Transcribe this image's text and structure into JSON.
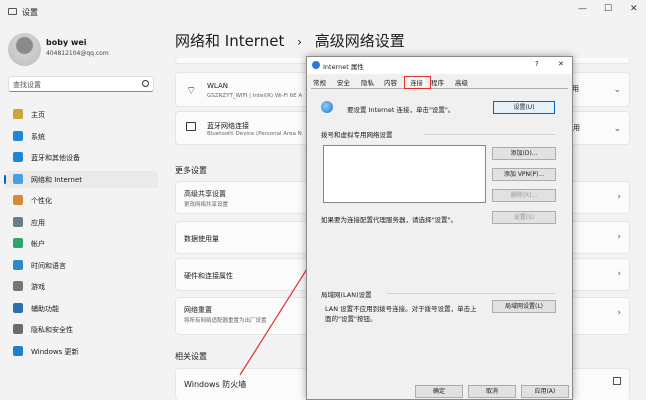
{
  "window": {
    "title": "设置",
    "controls": [
      "—",
      "☐",
      "✕"
    ]
  },
  "user": {
    "name": "boby wei",
    "email": "404812104@qq.com"
  },
  "search": {
    "placeholder": "查找设置"
  },
  "nav": [
    {
      "label": "主页",
      "icon": "home-icon",
      "color": "#c9a53b"
    },
    {
      "label": "系统",
      "icon": "system-icon",
      "color": "#1f86d6"
    },
    {
      "label": "蓝牙和其他设备",
      "icon": "bluetooth-icon",
      "color": "#1f86d6"
    },
    {
      "label": "网络和 Internet",
      "icon": "wifi-icon",
      "color": "#4a9fe0"
    },
    {
      "label": "个性化",
      "icon": "brush-icon",
      "color": "#d88a3a"
    },
    {
      "label": "应用",
      "icon": "apps-icon",
      "color": "#6e7b8b"
    },
    {
      "label": "帐户",
      "icon": "account-icon",
      "color": "#2ea36b"
    },
    {
      "label": "时间和语言",
      "icon": "globe-icon",
      "color": "#2e8bc9"
    },
    {
      "label": "游戏",
      "icon": "game-icon",
      "color": "#777"
    },
    {
      "label": "辅助功能",
      "icon": "accessibility-icon",
      "color": "#2a6fb0"
    },
    {
      "label": "隐私和安全性",
      "icon": "shield-icon",
      "color": "#6b6b6b"
    },
    {
      "label": "Windows 更新",
      "icon": "update-icon",
      "color": "#1e7fd0"
    }
  ],
  "breadcrumb": {
    "parent": "网络和 Internet",
    "sep": "›",
    "current": "高级网络设置"
  },
  "cards": [
    {
      "title": "WLAN",
      "sub": "GSZRZYT_WIFI | Intel(R) Wi-Fi 6E A",
      "icon": "wifi-icon"
    },
    {
      "title": "蓝牙网络连接",
      "sub": "Bluetooth Device (Personal Area N",
      "icon": "network-icon"
    }
  ],
  "more_settings": {
    "heading": "更多设置",
    "items": [
      {
        "title": "高级共享设置",
        "sub": "更改网络共享设置"
      },
      {
        "title": "数据使用量",
        "sub": ""
      },
      {
        "title": "硬件和连接属性",
        "sub": ""
      },
      {
        "title": "网络重置",
        "sub": "将所有网络适配器重置为出厂设置"
      }
    ]
  },
  "related": {
    "heading": "相关设置",
    "items": [
      {
        "title": "Windows 防火墙"
      }
    ]
  },
  "card_right": {
    "disable": "用",
    "disable2": "用"
  },
  "dialog": {
    "title": "Internet 属性",
    "help": "?",
    "close": "✕",
    "tabs": [
      "常规",
      "安全",
      "隐私",
      "内容",
      "连接",
      "程序",
      "高级"
    ],
    "setup_text": "要设置 Internet 连接，单击\"设置\"。",
    "setup_btn": "设置(U)",
    "vpn_heading": "拨号和虚拟专用网络设置",
    "add_btn": "添加(D)...",
    "add_vpn_btn": "添加 VPN(P)...",
    "remove_btn": "删除(R)...",
    "settings_btn": "设置(S)",
    "proxy_text": "如果要为连接配置代理服务器，请选择\"设置\"。",
    "lan_heading": "局域网(LAN)设置",
    "lan_text1": "LAN 设置不应用到拨号连接。对于拨号设置，单击上",
    "lan_text2": "面的\"设置\"按钮。",
    "lan_btn": "局域网设置(L)",
    "ok": "确定",
    "cancel": "取消",
    "apply": "应用(A)"
  },
  "colors": {
    "accent": "#0067c0",
    "annotation": "#e0302a"
  }
}
